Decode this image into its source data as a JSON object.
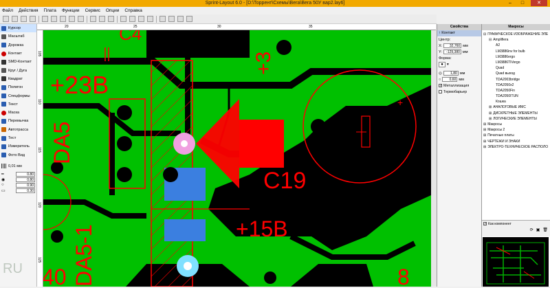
{
  "title": "Sprint-Layout 6.0 - [D:\\Торрент\\Схемы\\Вега\\Вега 50У вар2.lay6]",
  "window_buttons": {
    "min": "–",
    "max": "□",
    "close": "✕"
  },
  "menu": [
    "Файл",
    "Действия",
    "Плата",
    "Функции",
    "Сервис",
    "Опции",
    "Справка"
  ],
  "toolbar_icons": [
    "new-icon",
    "open-icon",
    "save-icon",
    "print-icon",
    "undo-icon",
    "redo-icon",
    "cut-icon",
    "copy-icon",
    "paste-icon",
    "delete-icon",
    "duplicate-icon",
    "rotate-icon",
    "mirror-icon",
    "align-icon",
    "group-icon",
    "ungroup-icon",
    "grid-icon",
    "zoom-icon",
    "layers-icon",
    "settings-icon"
  ],
  "left_tools": [
    {
      "label": "Курсор",
      "color": "#2a5db0",
      "selected": true
    },
    {
      "label": "Масштаб",
      "color": "#555555"
    },
    {
      "label": "Дорожка",
      "color": "#2a5db0"
    },
    {
      "label": "Контакт",
      "color": "#cc0000"
    },
    {
      "label": "SMD-Контакт",
      "color": "#333333"
    },
    {
      "label": "Круг / Дуга",
      "color": "#555555"
    },
    {
      "label": "Квадрат",
      "color": "#333333"
    },
    {
      "label": "Полигон",
      "color": "#2a5db0"
    },
    {
      "label": "Спецформы",
      "color": "#2a5db0"
    },
    {
      "label": "Текст",
      "color": "#2a5db0"
    },
    {
      "label": "Маска",
      "color": "#cc0000"
    },
    {
      "label": "Перемычка",
      "color": "#2a5db0"
    },
    {
      "label": "Автотрасса",
      "color": "#cc6600"
    },
    {
      "label": "Тест",
      "color": "#2a5db0"
    },
    {
      "label": "Измеритель",
      "color": "#2a5db0"
    },
    {
      "label": "Фото Вид",
      "color": "#2a5db0"
    }
  ],
  "grid_value": "0,01 мм",
  "tool_values": [
    "0.80",
    "0.80",
    "0.90",
    "0.30"
  ],
  "ruler_top_labels": [
    "20",
    "25",
    "30",
    "35"
  ],
  "ruler_left_labels": [
    "105",
    "110",
    "115",
    "120",
    "125"
  ],
  "canvas_texts": {
    "c4": "C4",
    "v23": "+23В",
    "da5": "DA5",
    "c19": "C19",
    "v15": "+15B",
    "da51": "DA5-1",
    "n40": "40",
    "n8": "8",
    "n3": "+3",
    "watermark": "RU",
    "plus": "+"
  },
  "props": {
    "header": "Свойства",
    "section": "↑ Контакт",
    "center_label": "Центр:",
    "x_label": "X:",
    "x_value": "32,760",
    "y_label": "Y:",
    "y_value": "-129,380",
    "unit": "мм",
    "form_label": "Форма:",
    "outer_value": "1,80",
    "inner_value": "0,60",
    "metallization": "Металлизация",
    "thermal": "Термобарьер"
  },
  "macros": {
    "header": "Макросы",
    "items": [
      {
        "label": "ГРАФИЧЕСКОЕ ИЗОБРАЖЕНИЕ ЭЛЕ",
        "indent": 0,
        "expander": "⊟"
      },
      {
        "label": "Amplifiera",
        "indent": 1,
        "expander": "⊟"
      },
      {
        "label": "A2",
        "indent": 2
      },
      {
        "label": "LM3886inv for bulb",
        "indent": 2
      },
      {
        "label": "LM3886ergo",
        "indent": 2
      },
      {
        "label": "LM3886TIVergo",
        "indent": 2
      },
      {
        "label": "Quad",
        "indent": 2
      },
      {
        "label": "Quad выход",
        "indent": 2
      },
      {
        "label": "TDA2003bridge",
        "indent": 2
      },
      {
        "label": "TDA2050x2",
        "indent": 2
      },
      {
        "label": "TDA2050Fin",
        "indent": 2
      },
      {
        "label": "TDA2050ITUN",
        "indent": 2
      },
      {
        "label": "Кошка",
        "indent": 2
      },
      {
        "label": "АНАЛОГОВЫЕ ИМС",
        "indent": 1,
        "expander": "⊞"
      },
      {
        "label": "ДИСКРЕТНЫЕ ЭЛЕМЕНТЫ",
        "indent": 1,
        "expander": "⊞"
      },
      {
        "label": "ЛОГИЧЕСКИЕ ЭЛЕМЕНТЫ",
        "indent": 1,
        "expander": "⊞"
      },
      {
        "label": "Макросы",
        "indent": 0,
        "expander": "⊞"
      },
      {
        "label": "Макросы 2",
        "indent": 0,
        "expander": "⊞"
      },
      {
        "label": "Печатные платы",
        "indent": 0,
        "expander": "⊞"
      },
      {
        "label": "ЧЕРТЕЖИ И ЗНАКИ",
        "indent": 0,
        "expander": "⊞"
      },
      {
        "label": "ЭЛЕКТРО-ТЕХНИЧЕСКОЕ РАСПОЛО",
        "indent": 0,
        "expander": "⊞"
      }
    ],
    "as_component": "Как компонент"
  },
  "colors": {
    "copper": "#00c000",
    "silk": "#ff0000",
    "pad_pink": "#f0a0e0",
    "pad_cyan": "#80e0ff",
    "blue": "#3b7fe0",
    "titlebar": "#f2a900"
  }
}
